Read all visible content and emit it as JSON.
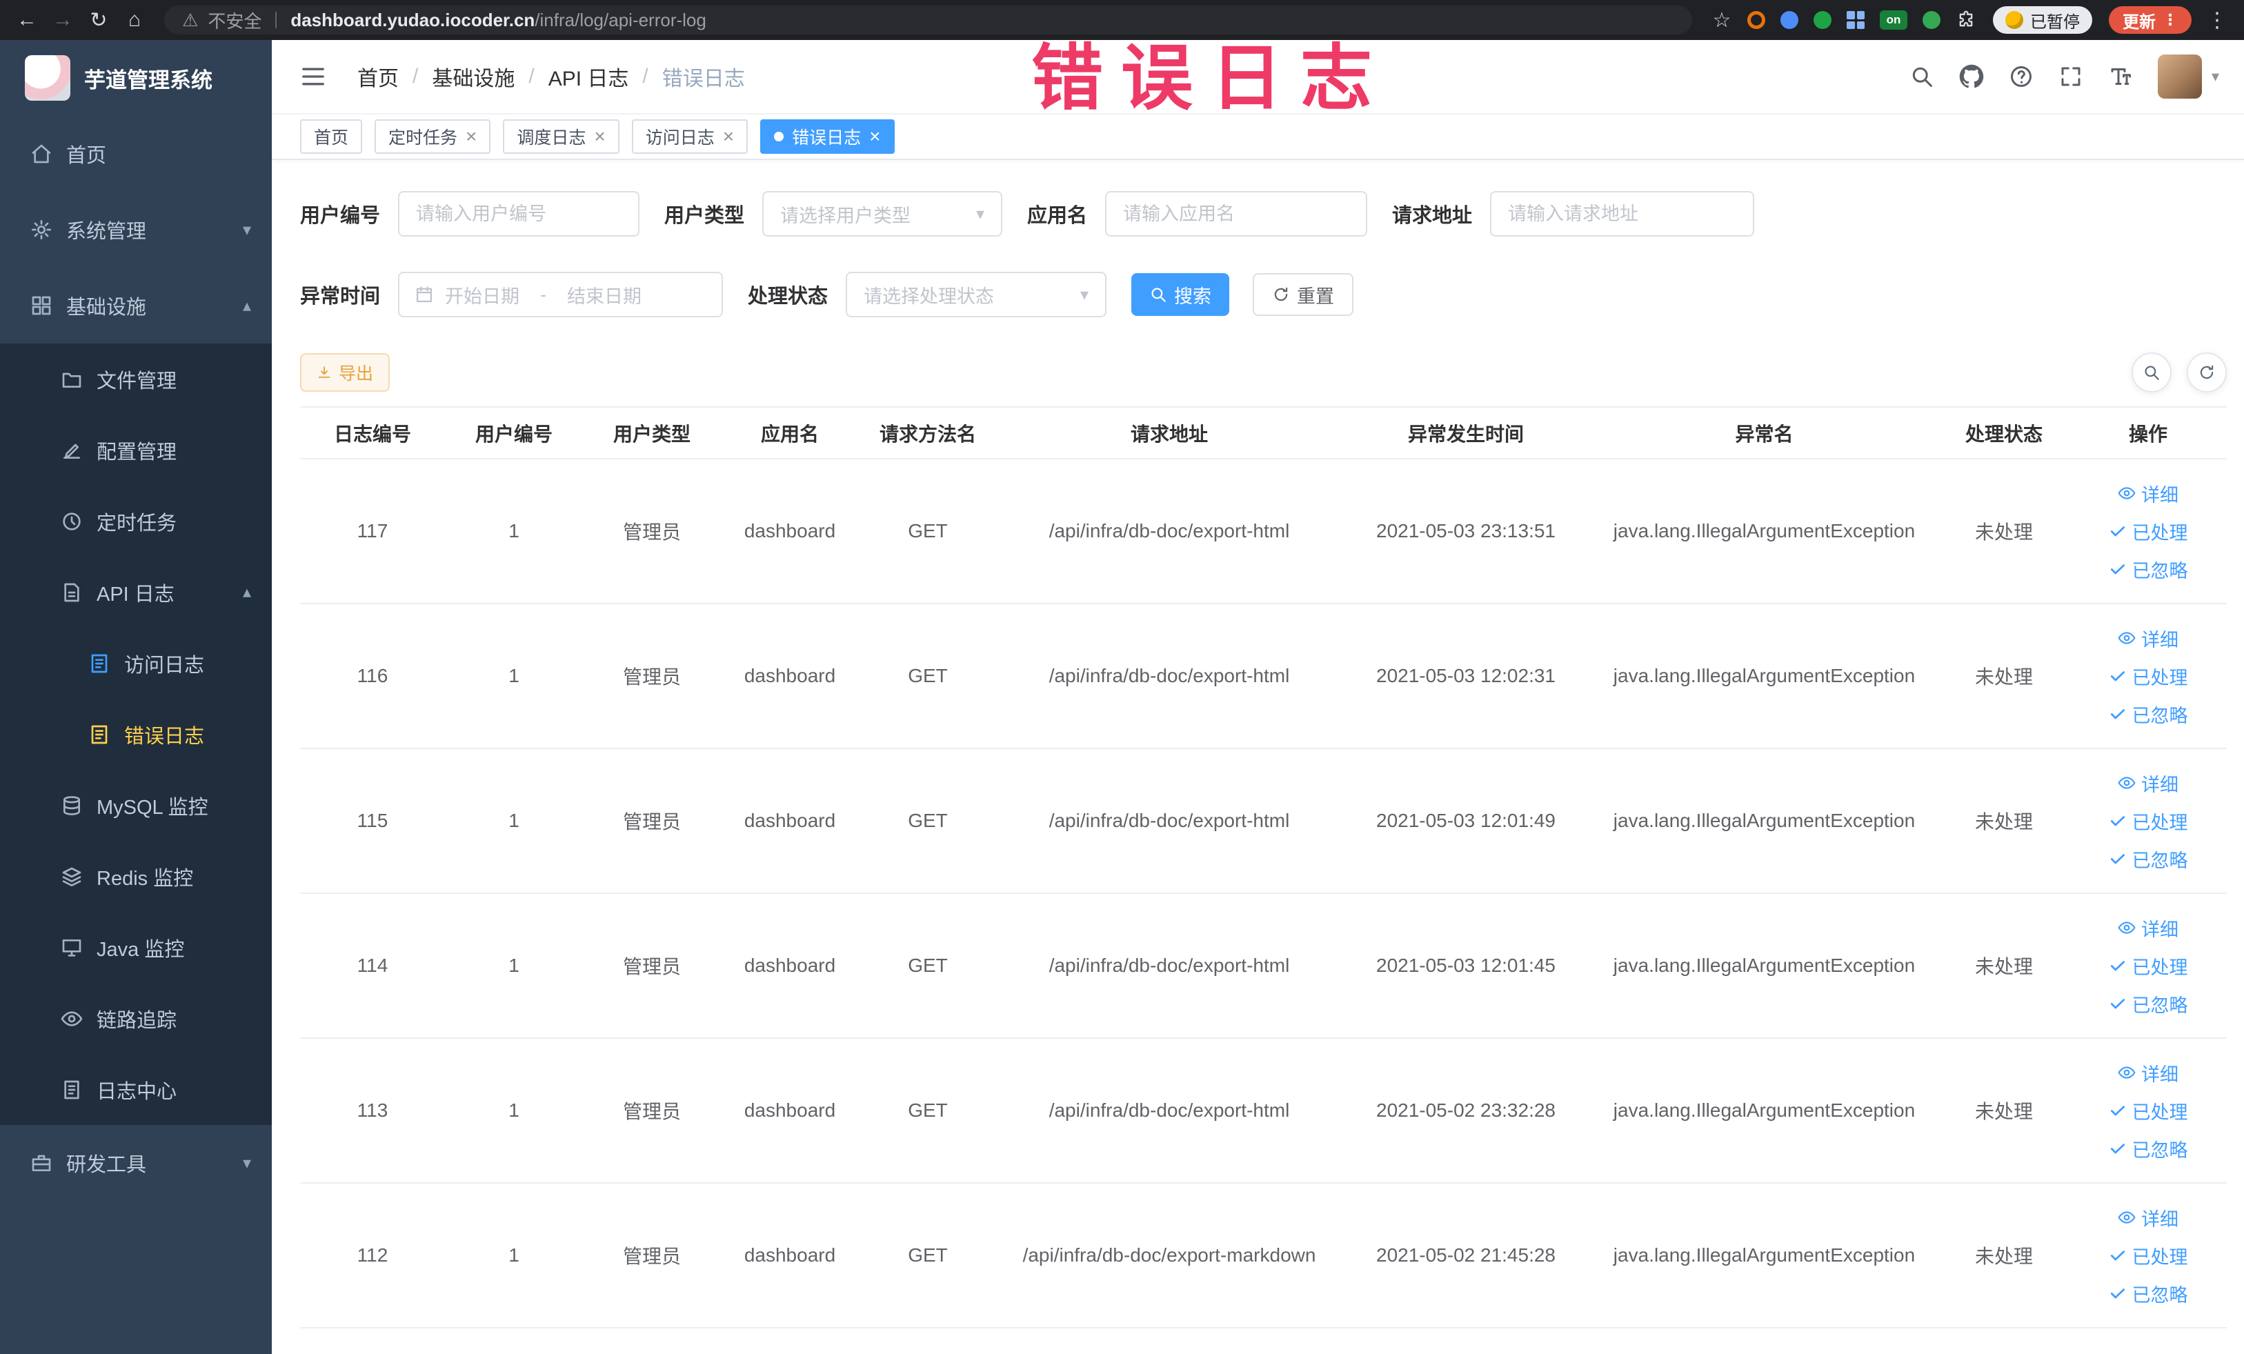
{
  "browser": {
    "security_label": "不安全",
    "url_host": "dashboard.yudao.iocoder.cn",
    "url_path": "/infra/log/api-error-log",
    "extension_badge": "on",
    "paused_badge": "已暂停",
    "update_button": "更新"
  },
  "overlay": {
    "annotation": "错误日志"
  },
  "sidebar": {
    "logo_title": "芋道管理系统",
    "items": [
      {
        "label": "首页",
        "icon": "home-icon",
        "level": 0
      },
      {
        "label": "系统管理",
        "icon": "gear-icon",
        "level": 0,
        "chevron": "down"
      },
      {
        "label": "基础设施",
        "icon": "infra-icon",
        "level": 0,
        "chevron": "up"
      },
      {
        "label": "文件管理",
        "icon": "folder-icon",
        "level": 1,
        "submenu": true
      },
      {
        "label": "配置管理",
        "icon": "edit-icon",
        "level": 1,
        "submenu": true
      },
      {
        "label": "定时任务",
        "icon": "schedule-icon",
        "level": 1,
        "submenu": true
      },
      {
        "label": "API 日志",
        "icon": "api-log-icon",
        "level": 1,
        "submenu": true,
        "chevron": "up"
      },
      {
        "label": "访问日志",
        "icon": "doc-icon",
        "level": 2,
        "submenu": true,
        "icon_color": "#409eff"
      },
      {
        "label": "错误日志",
        "icon": "doc-icon",
        "level": 2,
        "submenu": true,
        "active": true
      },
      {
        "label": "MySQL 监控",
        "icon": "database-icon",
        "level": 1,
        "submenu": true
      },
      {
        "label": "Redis 监控",
        "icon": "redis-icon",
        "level": 1,
        "submenu": true
      },
      {
        "label": "Java 监控",
        "icon": "java-icon",
        "level": 1,
        "submenu": true
      },
      {
        "label": "链路追踪",
        "icon": "trace-icon",
        "level": 1,
        "submenu": true
      },
      {
        "label": "日志中心",
        "icon": "log-center-icon",
        "level": 1,
        "submenu": true
      },
      {
        "label": "研发工具",
        "icon": "tools-icon",
        "level": 0,
        "chevron": "down"
      }
    ]
  },
  "header": {
    "breadcrumb": [
      "首页",
      "基础设施",
      "API 日志",
      "错误日志"
    ]
  },
  "tabs": [
    {
      "label": "首页",
      "closable": false,
      "active": false
    },
    {
      "label": "定时任务",
      "closable": true,
      "active": false
    },
    {
      "label": "调度日志",
      "closable": true,
      "active": false
    },
    {
      "label": "访问日志",
      "closable": true,
      "active": false
    },
    {
      "label": "错误日志",
      "closable": true,
      "active": true
    }
  ],
  "filters": {
    "user_id": {
      "label": "用户编号",
      "placeholder": "请输入用户编号"
    },
    "user_type": {
      "label": "用户类型",
      "placeholder": "请选择用户类型"
    },
    "app_name": {
      "label": "应用名",
      "placeholder": "请输入应用名"
    },
    "request_url": {
      "label": "请求地址",
      "placeholder": "请输入请求地址"
    },
    "exception_time": {
      "label": "异常时间",
      "start_placeholder": "开始日期",
      "separator": "-",
      "end_placeholder": "结束日期"
    },
    "process_status": {
      "label": "处理状态",
      "placeholder": "请选择处理状态"
    },
    "search_button": "搜索",
    "reset_button": "重置"
  },
  "toolbar": {
    "export_button": "导出"
  },
  "table": {
    "columns": [
      "日志编号",
      "用户编号",
      "用户类型",
      "应用名",
      "请求方法名",
      "请求地址",
      "异常发生时间",
      "异常名",
      "处理状态",
      "操作"
    ],
    "actions": {
      "detail": "详细",
      "processed": "已处理",
      "ignored": "已忽略"
    },
    "rows": [
      {
        "id": "117",
        "user_id": "1",
        "user_type": "管理员",
        "app": "dashboard",
        "method": "GET",
        "url": "/api/infra/db-doc/export-html",
        "time": "2021-05-03 23:13:51",
        "exception": "java.lang.IllegalArgumentException",
        "status": "未处理"
      },
      {
        "id": "116",
        "user_id": "1",
        "user_type": "管理员",
        "app": "dashboard",
        "method": "GET",
        "url": "/api/infra/db-doc/export-html",
        "time": "2021-05-03 12:02:31",
        "exception": "java.lang.IllegalArgumentException",
        "status": "未处理"
      },
      {
        "id": "115",
        "user_id": "1",
        "user_type": "管理员",
        "app": "dashboard",
        "method": "GET",
        "url": "/api/infra/db-doc/export-html",
        "time": "2021-05-03 12:01:49",
        "exception": "java.lang.IllegalArgumentException",
        "status": "未处理"
      },
      {
        "id": "114",
        "user_id": "1",
        "user_type": "管理员",
        "app": "dashboard",
        "method": "GET",
        "url": "/api/infra/db-doc/export-html",
        "time": "2021-05-03 12:01:45",
        "exception": "java.lang.IllegalArgumentException",
        "status": "未处理"
      },
      {
        "id": "113",
        "user_id": "1",
        "user_type": "管理员",
        "app": "dashboard",
        "method": "GET",
        "url": "/api/infra/db-doc/export-html",
        "time": "2021-05-02 23:32:28",
        "exception": "java.lang.IllegalArgumentException",
        "status": "未处理"
      },
      {
        "id": "112",
        "user_id": "1",
        "user_type": "管理员",
        "app": "dashboard",
        "method": "GET",
        "url": "/api/infra/db-doc/export-markdown",
        "time": "2021-05-02 21:45:28",
        "exception": "java.lang.IllegalArgumentException",
        "status": "未处理"
      }
    ]
  }
}
